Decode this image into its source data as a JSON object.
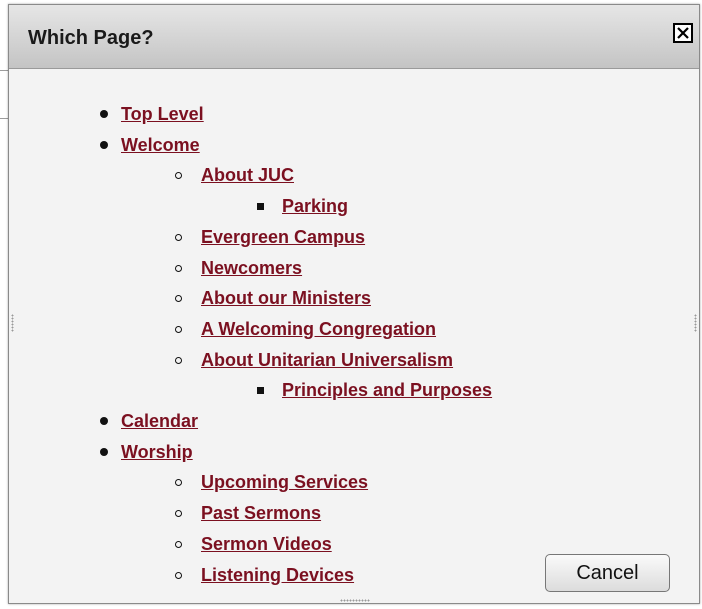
{
  "dialog": {
    "title": "Which Page?",
    "close_icon": "close-icon",
    "cancel_label": "Cancel"
  },
  "pages": [
    {
      "label": "Top Level",
      "level": 1
    },
    {
      "label": "Welcome",
      "level": 1
    },
    {
      "label": "About JUC",
      "level": 2
    },
    {
      "label": "Parking",
      "level": 3
    },
    {
      "label": "Evergreen Campus",
      "level": 2
    },
    {
      "label": "Newcomers",
      "level": 2
    },
    {
      "label": "About our Ministers",
      "level": 2
    },
    {
      "label": "A Welcoming Congregation",
      "level": 2
    },
    {
      "label": "About Unitarian Universalism",
      "level": 2
    },
    {
      "label": "Principles and Purposes",
      "level": 3
    },
    {
      "label": "Calendar",
      "level": 1
    },
    {
      "label": "Worship",
      "level": 1
    },
    {
      "label": "Upcoming Services",
      "level": 2
    },
    {
      "label": "Past Sermons",
      "level": 2
    },
    {
      "label": "Sermon Videos",
      "level": 2
    },
    {
      "label": "Listening Devices",
      "level": 2
    }
  ],
  "colors": {
    "link": "#7b1020",
    "titlebar": "#d4d4d4",
    "dialog_bg": "#f3f3f3"
  }
}
